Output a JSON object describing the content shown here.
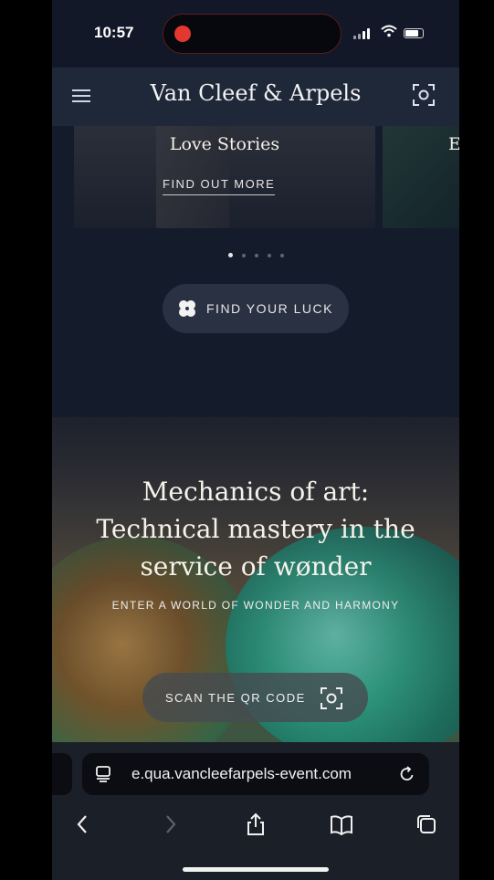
{
  "status_bar": {
    "time": "10:57",
    "recording_dot_color": "#e2382f"
  },
  "header": {
    "brand": "Van Cleef & Arpels",
    "menu_icon": "hamburger-menu-icon",
    "scan_icon": "scan-viewfinder-icon"
  },
  "carousel": {
    "slide_title": "Love Stories",
    "slide_link": "FIND OUT MORE",
    "next_slide_partial": "E",
    "dots_count": 5,
    "active_dot": 1
  },
  "luck_button": {
    "label": "FIND YOUR LUCK",
    "icon": "clover-icon"
  },
  "hero": {
    "title_line1": "Mechanics of art:",
    "title_line2": "Technical mastery in the",
    "title_line3": "service of wønder",
    "subtitle": "ENTER A WORLD OF WONDER AND HARMONY",
    "scan_button": "SCAN THE QR CODE"
  },
  "browser": {
    "url": "e.qua.vancleefarpels-event.com",
    "url_icon": "page-menu-icon",
    "reload_icon": "reload-icon",
    "toolbar": [
      "back-icon",
      "forward-icon",
      "share-icon",
      "bookmarks-icon",
      "tabs-icon"
    ]
  }
}
